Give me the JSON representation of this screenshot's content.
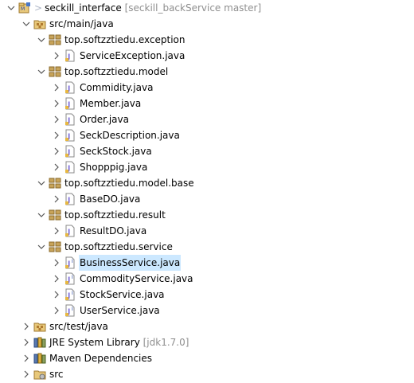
{
  "colors": {
    "selection": "#cce8ff",
    "decoration_gray": "#8f8f8f",
    "package": "#c8a45a",
    "java_file": "#7a6ad8"
  },
  "tree": [
    {
      "label": "seckill_interface",
      "decoration": "[seckill_backService master]",
      "marker": ">",
      "icon": "maven-project-icon",
      "level": 0,
      "expanded": true
    },
    {
      "label": "src/main/java",
      "icon": "source-folder-icon",
      "level": 1,
      "expanded": true
    },
    {
      "label": "top.softzztiedu.exception",
      "icon": "package-icon",
      "level": 2,
      "expanded": true
    },
    {
      "label": "ServiceException.java",
      "icon": "java-class-icon",
      "level": 3,
      "expanded": false
    },
    {
      "label": "top.softzztiedu.model",
      "icon": "package-icon",
      "level": 2,
      "expanded": true
    },
    {
      "label": "Commidity.java",
      "icon": "java-class-icon",
      "level": 3,
      "expanded": false
    },
    {
      "label": "Member.java",
      "icon": "java-class-icon",
      "level": 3,
      "expanded": false
    },
    {
      "label": "Order.java",
      "icon": "java-class-icon",
      "level": 3,
      "expanded": false
    },
    {
      "label": "SeckDescription.java",
      "icon": "java-class-icon",
      "level": 3,
      "expanded": false
    },
    {
      "label": "SeckStock.java",
      "icon": "java-class-icon",
      "level": 3,
      "expanded": false
    },
    {
      "label": "Shopppig.java",
      "icon": "java-class-icon",
      "level": 3,
      "expanded": false
    },
    {
      "label": "top.softzztiedu.model.base",
      "icon": "package-icon",
      "level": 2,
      "expanded": true
    },
    {
      "label": "BaseDO.java",
      "icon": "java-class-icon",
      "level": 3,
      "expanded": false
    },
    {
      "label": "top.softzztiedu.result",
      "icon": "package-icon",
      "level": 2,
      "expanded": true
    },
    {
      "label": "ResultDO.java",
      "icon": "java-class-icon",
      "level": 3,
      "expanded": false
    },
    {
      "label": "top.softzztiedu.service",
      "icon": "package-icon",
      "level": 2,
      "expanded": true
    },
    {
      "label": "BusinessService.java",
      "icon": "java-interface-icon",
      "level": 3,
      "expanded": false,
      "selected": true
    },
    {
      "label": "CommodityService.java",
      "icon": "java-interface-icon",
      "level": 3,
      "expanded": false
    },
    {
      "label": "StockService.java",
      "icon": "java-interface-icon",
      "level": 3,
      "expanded": false
    },
    {
      "label": "UserService.java",
      "icon": "java-interface-icon",
      "level": 3,
      "expanded": false
    },
    {
      "label": "src/test/java",
      "icon": "source-folder-icon",
      "level": 1,
      "expanded": false
    },
    {
      "label": "JRE System Library",
      "decoration": "[jdk1.7.0]",
      "icon": "library-icon",
      "level": 1,
      "expanded": false
    },
    {
      "label": "Maven Dependencies",
      "icon": "library-icon",
      "level": 1,
      "expanded": false
    },
    {
      "label": "src",
      "icon": "folder-icon",
      "level": 1,
      "expanded": false
    }
  ]
}
